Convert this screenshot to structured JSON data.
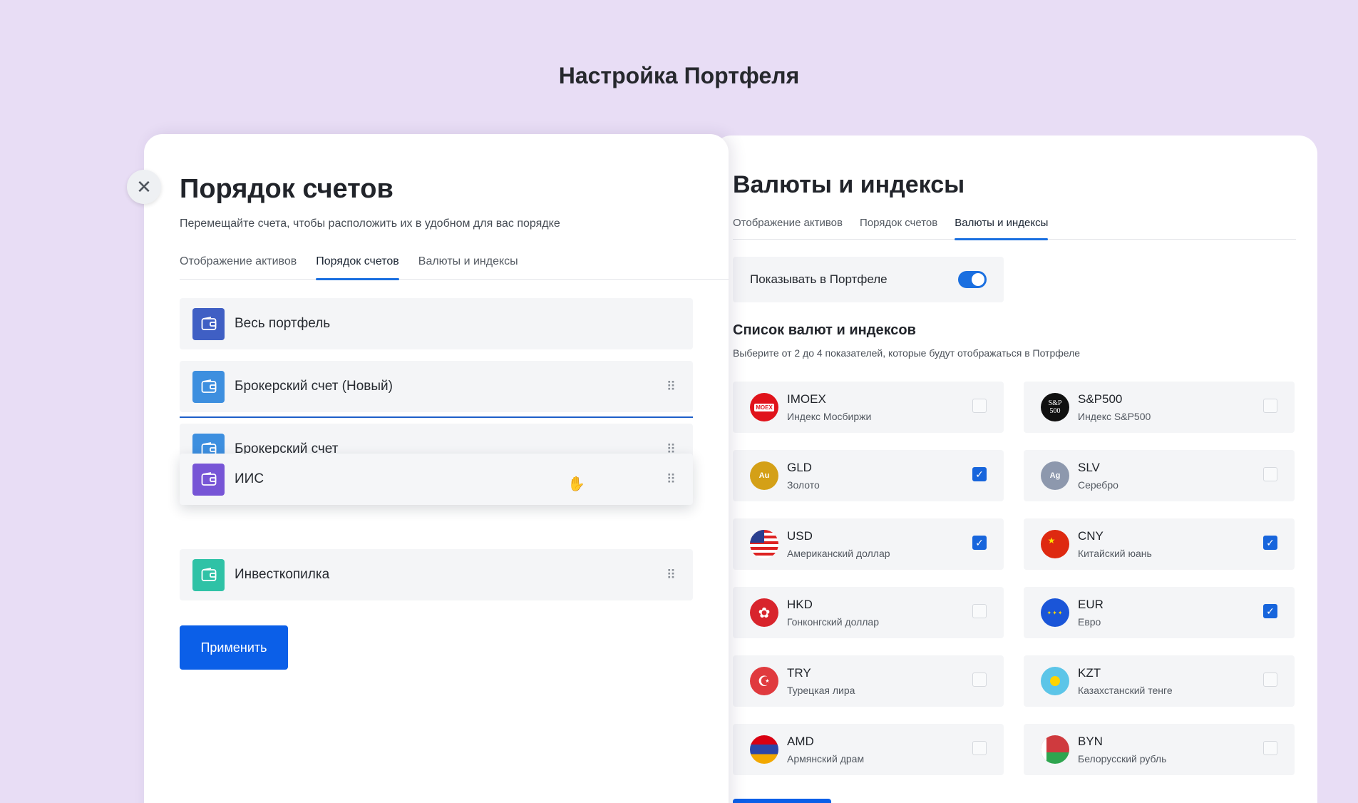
{
  "page_title": "Настройка Портфеля",
  "left": {
    "heading": "Порядок счетов",
    "description": "Перемещайте счета, чтобы расположить их в удобном для вас порядке",
    "tabs": [
      {
        "label": "Отображение активов"
      },
      {
        "label": "Порядок счетов"
      },
      {
        "label": "Валюты и индексы"
      }
    ],
    "accounts": [
      {
        "label": "Весь портфель",
        "color": "#3f5fc4"
      },
      {
        "label": "Брокерский счет (Новый)",
        "color": "#3d8fdf"
      },
      {
        "label": "Брокерский счет",
        "color": "#3d8fdf"
      },
      {
        "label": "ИИС",
        "color": "#7755d6"
      },
      {
        "label": "Инвесткопилка",
        "color": "#2fc2a6"
      }
    ],
    "apply_label": "Применить"
  },
  "right": {
    "heading": "Валюты и индексы",
    "tabs": [
      {
        "label": "Отображение активов"
      },
      {
        "label": "Порядок счетов"
      },
      {
        "label": "Валюты и индексы"
      }
    ],
    "toggle_label": "Показывать в Портфеле",
    "toggle_on": true,
    "list_heading": "Список валют и индексов",
    "list_desc": "Выберите от 2 до 4 показателей, которые будут отображаться в Потрфеле",
    "items": [
      {
        "code": "IMOEX",
        "name": "Индекс Мосбиржи",
        "checked": false,
        "badge": "MOEX",
        "icon": "imoex-icon"
      },
      {
        "code": "S&P500",
        "name": "Индекс S&P500",
        "checked": false,
        "badge": "S&P 500",
        "icon": "sp500-icon"
      },
      {
        "code": "GLD",
        "name": "Золото",
        "checked": true,
        "badge": "Au",
        "icon": "gold-icon"
      },
      {
        "code": "SLV",
        "name": "Серебро",
        "checked": false,
        "badge": "Ag",
        "icon": "silver-icon"
      },
      {
        "code": "USD",
        "name": "Американский доллар",
        "checked": true,
        "icon": "us-flag-icon"
      },
      {
        "code": "CNY",
        "name": "Китайский юань",
        "checked": true,
        "icon": "cn-flag-icon"
      },
      {
        "code": "HKD",
        "name": "Гонконгский доллар",
        "checked": false,
        "icon": "hk-flag-icon"
      },
      {
        "code": "EUR",
        "name": "Евро",
        "checked": true,
        "icon": "eu-flag-icon"
      },
      {
        "code": "TRY",
        "name": "Турецкая лира",
        "checked": false,
        "icon": "tr-flag-icon"
      },
      {
        "code": "KZT",
        "name": "Казахстанский тенге",
        "checked": false,
        "icon": "kz-flag-icon"
      },
      {
        "code": "AMD",
        "name": "Армянский драм",
        "checked": false,
        "icon": "am-flag-icon"
      },
      {
        "code": "BYN",
        "name": "Белорусский рубль",
        "checked": false,
        "icon": "by-flag-icon"
      }
    ]
  },
  "colors": {
    "accent": "#1a6fe0",
    "background": "#e8ddf5"
  }
}
